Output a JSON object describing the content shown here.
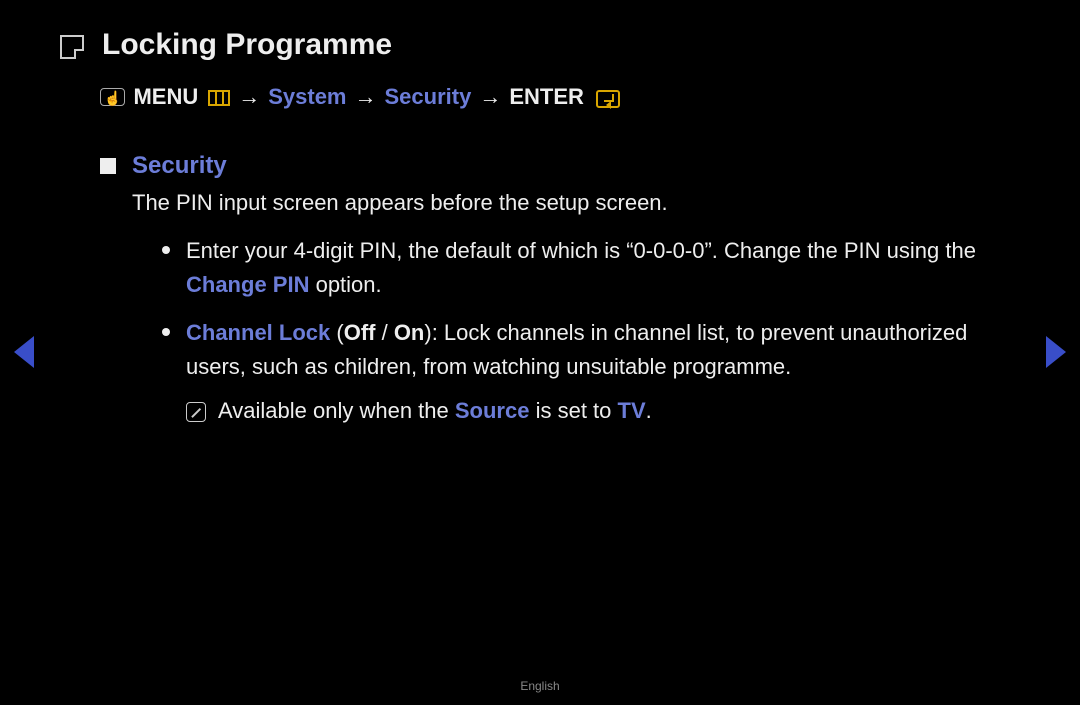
{
  "title": "Locking Programme",
  "breadcrumb": {
    "menu_label": "MENU",
    "system_label": "System",
    "security_label": "Security",
    "enter_label": "ENTER"
  },
  "section": {
    "heading": "Security",
    "description": "The PIN input screen appears before the setup screen."
  },
  "bullets": {
    "pin_pre": "Enter your 4-digit PIN, the default of which is “0-0-0-0”. Change the PIN using the ",
    "change_pin_label": "Change PIN",
    "pin_post": " option.",
    "channel_lock_label": "Channel Lock",
    "channel_paren_open": " (",
    "off_label": "Off",
    "slash": " / ",
    "on_label": "On",
    "channel_desc": "): Lock channels in channel list, to prevent unauthorized users, such as children, from watching unsuitable programme."
  },
  "note": {
    "pre": "Available only when the ",
    "source_label": "Source",
    "mid": " is set to ",
    "tv_label": "TV",
    "post": "."
  },
  "footer": "English"
}
